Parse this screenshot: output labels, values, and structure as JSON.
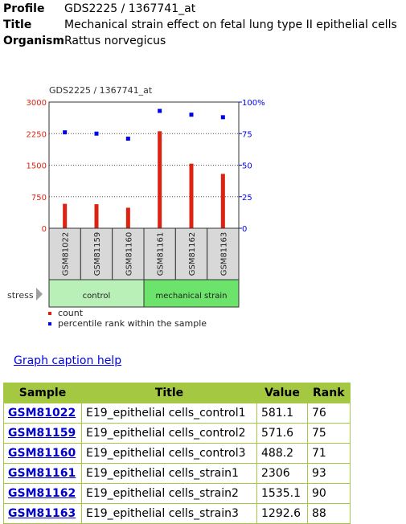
{
  "meta": {
    "profile_label": "Profile",
    "profile_value": "GDS2225 / 1367741_at",
    "title_label": "Title",
    "title_value": "Mechanical strain effect on fetal lung type II epithelial cells",
    "organism_label": "Organism",
    "organism_value": "Rattus norvegicus"
  },
  "colors": {
    "count": "#dd2211",
    "percentile": "#0000ee",
    "control": "#b8f0b8",
    "mechanical_strain": "#6ce46c",
    "sample_box": "#d8d8d8",
    "table_header": "#a5c842"
  },
  "chart_data": {
    "type": "bar",
    "title": "GDS2225 / 1367741_at",
    "categories": [
      "GSM81022",
      "GSM81159",
      "GSM81160",
      "GSM81161",
      "GSM81162",
      "GSM81163"
    ],
    "series": [
      {
        "name": "count",
        "axis": "left",
        "type": "bar",
        "values": [
          581.1,
          571.6,
          488.2,
          2306,
          1535.1,
          1292.6
        ]
      },
      {
        "name": "percentile rank within the sample",
        "axis": "right",
        "type": "scatter",
        "values": [
          76,
          75,
          71,
          93,
          90,
          88
        ]
      }
    ],
    "left_axis": {
      "ylim": [
        0,
        3000
      ],
      "ticks": [
        "0",
        "750",
        "1500",
        "2250",
        "3000"
      ],
      "tick_values": [
        0,
        750,
        1500,
        2250,
        3000
      ]
    },
    "right_axis": {
      "ylim": [
        0,
        100
      ],
      "ticks": [
        "0",
        "25",
        "50",
        "75",
        "100%"
      ],
      "tick_values": [
        0,
        25,
        50,
        75,
        100
      ]
    },
    "grid": "dotted horizontal at 750, 1500, 2250",
    "factor": {
      "name": "stress",
      "groups": [
        {
          "label": "control",
          "count": 3
        },
        {
          "label": "mechanical strain",
          "count": 3
        }
      ]
    },
    "legend": {
      "placement": "bottom-left",
      "entries": [
        "count",
        "percentile rank within the sample"
      ]
    }
  },
  "help_link": "Graph caption help",
  "table": {
    "headers": [
      "Sample",
      "Title",
      "Value",
      "Rank"
    ],
    "rows": [
      {
        "sample": "GSM81022",
        "title": "E19_epithelial cells_control1",
        "value": "581.1",
        "rank": "76"
      },
      {
        "sample": "GSM81159",
        "title": "E19_epithelial cells_control2",
        "value": "571.6",
        "rank": "75"
      },
      {
        "sample": "GSM81160",
        "title": "E19_epithelial cells_control3",
        "value": "488.2",
        "rank": "71"
      },
      {
        "sample": "GSM81161",
        "title": "E19_epithelial cells_strain1",
        "value": "2306",
        "rank": "93"
      },
      {
        "sample": "GSM81162",
        "title": "E19_epithelial cells_strain2",
        "value": "1535.1",
        "rank": "90"
      },
      {
        "sample": "GSM81163",
        "title": "E19_epithelial cells_strain3",
        "value": "1292.6",
        "rank": "88"
      }
    ]
  }
}
